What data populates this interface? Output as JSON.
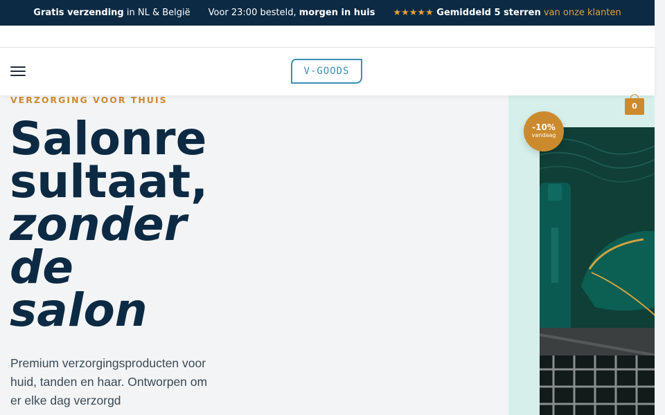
{
  "announcement": {
    "shipping_bold": "Gratis verzending",
    "shipping_rest": " in NL & België",
    "delivery_pre": "Voor 23:00 besteld, ",
    "delivery_bold": "morgen in huis",
    "rating_stars": "★★★★★",
    "rating_bold": " Gemiddeld 5 sterren",
    "rating_rest": " van onze klanten"
  },
  "header": {
    "logo_text": "V-GOODS",
    "cart_count": "0"
  },
  "hero": {
    "eyebrow": "VERZORGING VOOR THUIS",
    "title_line1": "Salonre",
    "title_line2": "sultaat,",
    "title_line3": "zonder",
    "title_line4": "de",
    "title_line5": "salon",
    "description": "Premium verzorgingsproducten voor huid, tanden en haar. Ontworpen om er elke dag verzorgd",
    "badge_percent": "-10%",
    "badge_label": "vandaag"
  },
  "colors": {
    "navy": "#0c2a43",
    "accent_gold": "#cc8a2e",
    "mint_panel": "#d6efea",
    "logo_blue": "#3a8fb2"
  }
}
